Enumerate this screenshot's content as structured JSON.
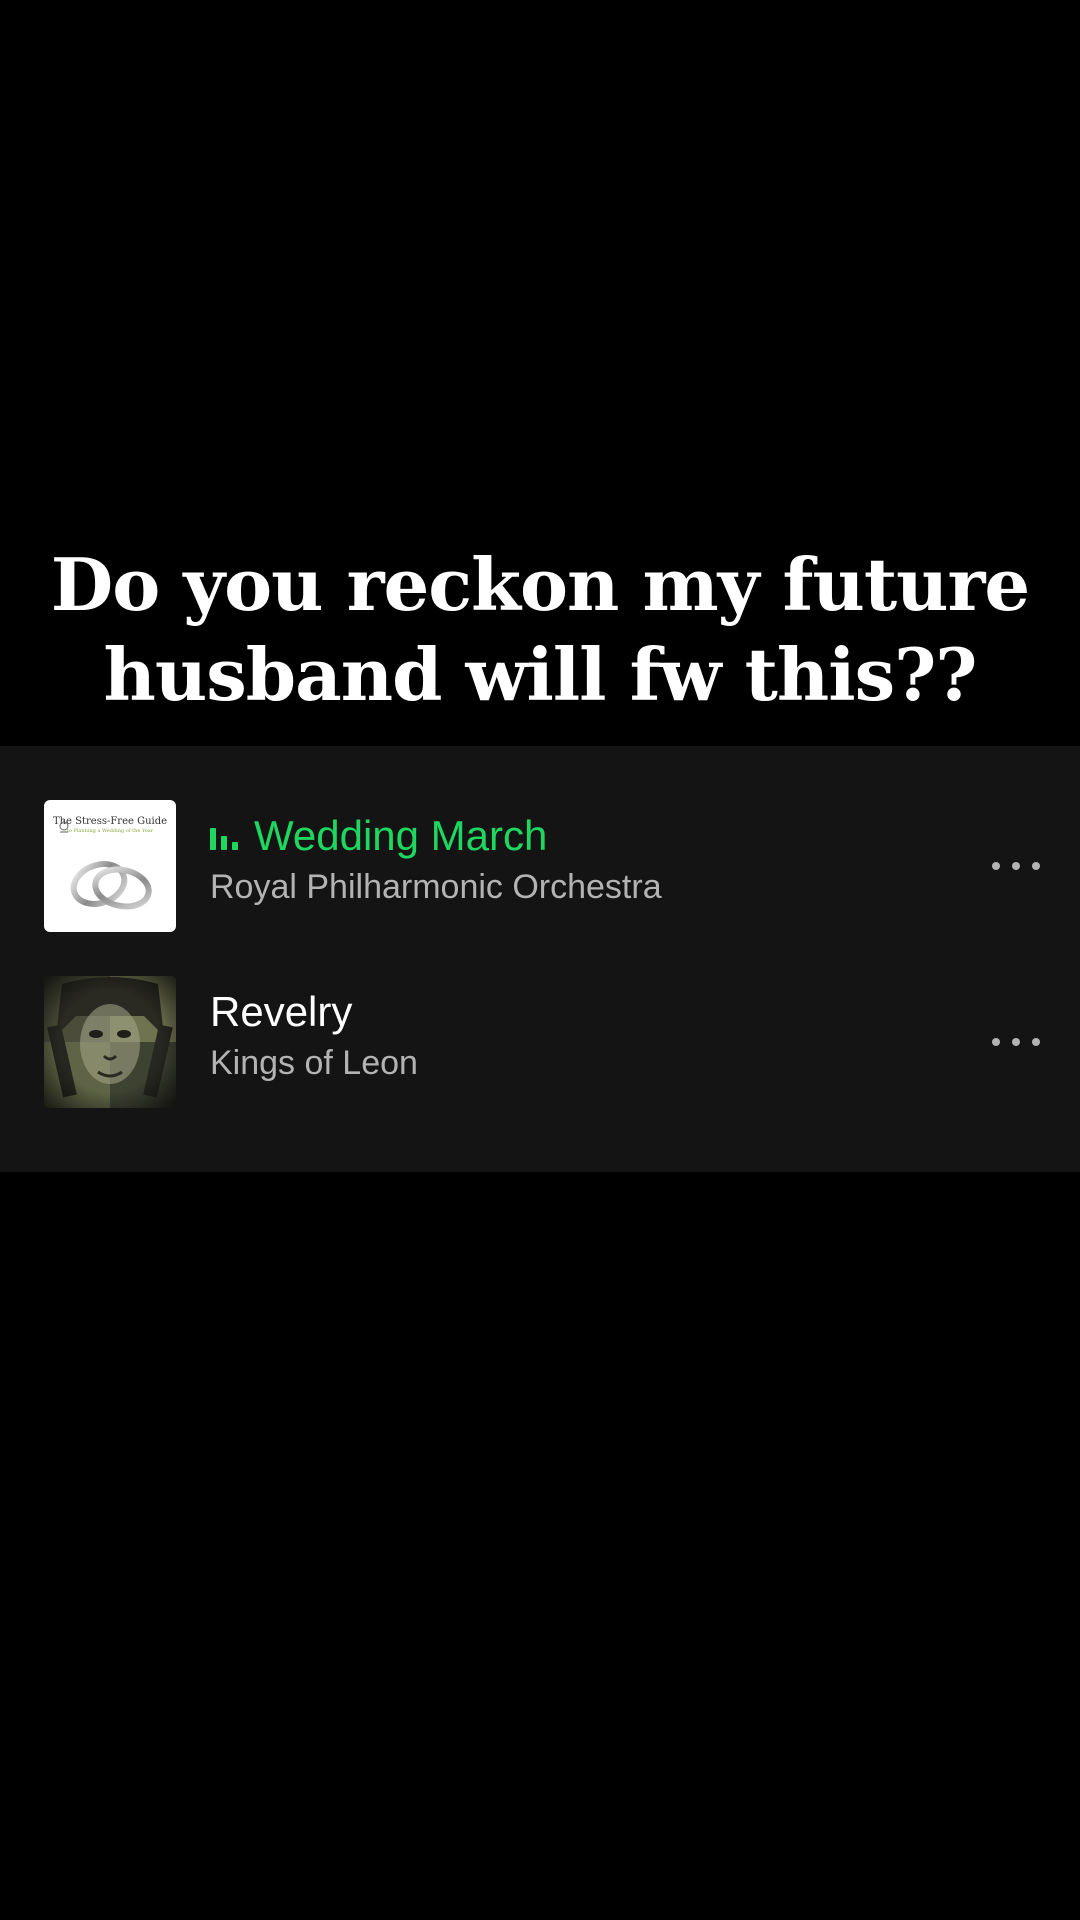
{
  "caption": {
    "line1": "Do you reckon my future",
    "line2": "husband will fw this??"
  },
  "tracks": [
    {
      "title": "Wedding March",
      "artist": "Royal Philharmonic Orchestra",
      "playing": true,
      "art": {
        "title": "The Stress-Free Guide",
        "subtitle": "to Planning a Wedding of the Year",
        "icon": "wedding-rings"
      }
    },
    {
      "title": "Revelry",
      "artist": "Kings of Leon",
      "playing": false,
      "art": {
        "icon": "face-collage"
      }
    }
  ],
  "colors": {
    "background": "#000000",
    "card": "#141414",
    "accent_green": "#1ed760",
    "secondary_text": "#b3b3b3"
  }
}
